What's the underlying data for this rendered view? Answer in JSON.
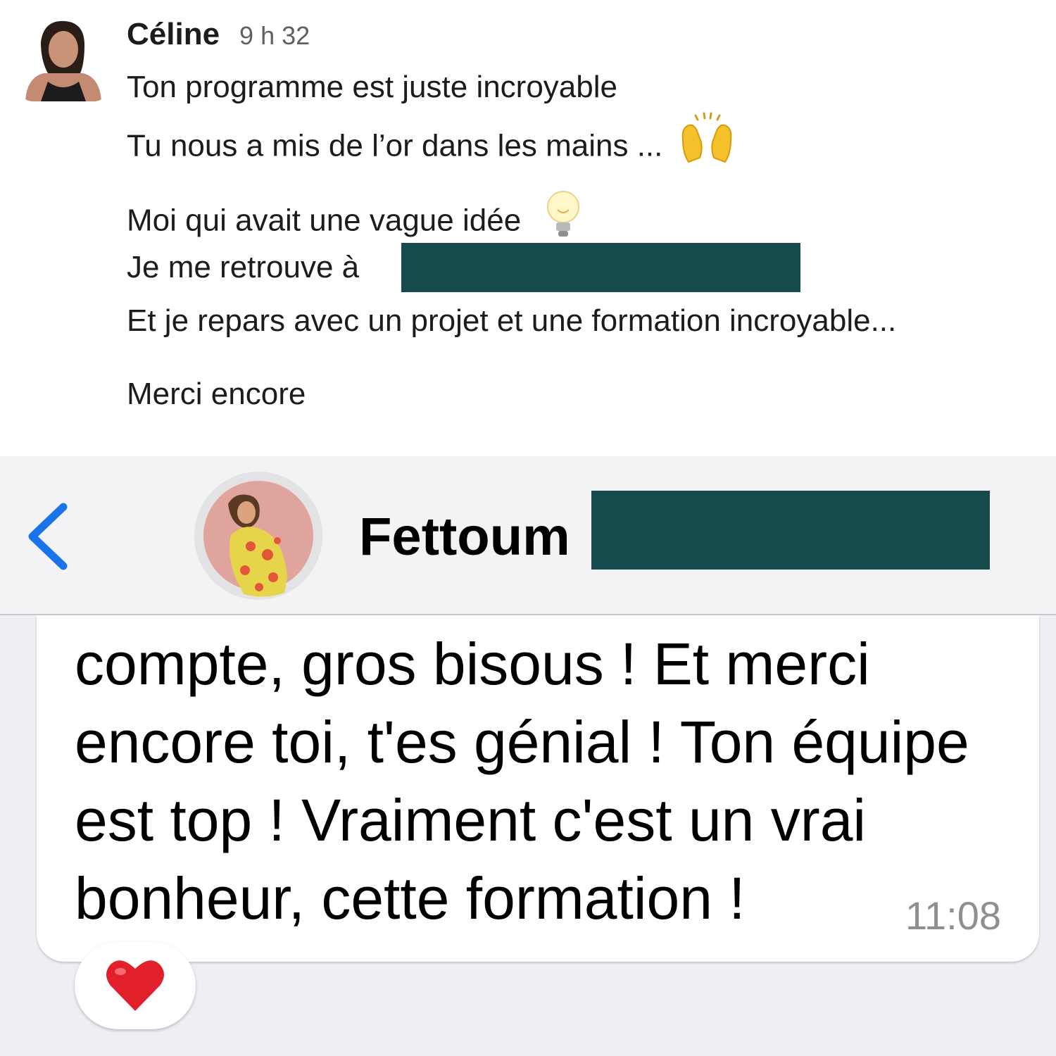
{
  "slack_message": {
    "author": "Céline",
    "time": "9 h 32",
    "lines": [
      "Ton programme est juste incroyable",
      "Tu nous a mis de l’or dans les mains ...",
      "Moi qui avait une vague idée",
      "Je me retrouve à",
      "Et je repars avec un projet et une formation incroyable...",
      "Merci encore"
    ],
    "emojis": [
      "raising-hands-icon",
      "light-bulb-icon"
    ]
  },
  "chat": {
    "contact_name": "Fettoum",
    "message_text": "compte, gros bisous ! Et merci encore toi, t'es génial ! Ton équipe est top ! Vraiment c'est un vrai bonheur, cette formation !",
    "message_time": "11:08",
    "reaction": "heart-icon"
  },
  "colors": {
    "redaction": "#174a4c",
    "back_chevron": "#1a73e8",
    "chat_background": "#eeeff3",
    "header_background": "#f3f3f5"
  }
}
